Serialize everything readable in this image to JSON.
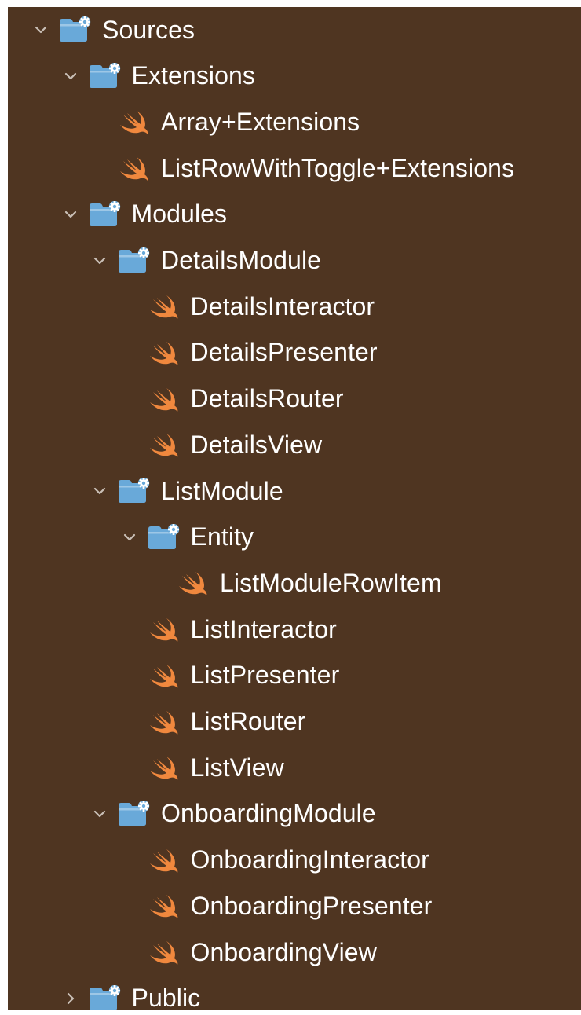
{
  "tree": [
    {
      "label": "Sources",
      "kind": "folder",
      "depth": 0,
      "state": "expanded",
      "icon": "folder-gear-icon"
    },
    {
      "label": "Extensions",
      "kind": "folder",
      "depth": 1,
      "state": "expanded",
      "icon": "folder-gear-icon"
    },
    {
      "label": "Array+Extensions",
      "kind": "file",
      "depth": 2,
      "icon": "swift-icon"
    },
    {
      "label": "ListRowWithToggle+Extensions",
      "kind": "file",
      "depth": 2,
      "icon": "swift-icon"
    },
    {
      "label": "Modules",
      "kind": "folder",
      "depth": 1,
      "state": "expanded",
      "icon": "folder-gear-icon"
    },
    {
      "label": "DetailsModule",
      "kind": "folder",
      "depth": 2,
      "state": "expanded",
      "icon": "folder-gear-icon"
    },
    {
      "label": "DetailsInteractor",
      "kind": "file",
      "depth": 3,
      "icon": "swift-icon"
    },
    {
      "label": "DetailsPresenter",
      "kind": "file",
      "depth": 3,
      "icon": "swift-icon"
    },
    {
      "label": "DetailsRouter",
      "kind": "file",
      "depth": 3,
      "icon": "swift-icon"
    },
    {
      "label": "DetailsView",
      "kind": "file",
      "depth": 3,
      "icon": "swift-icon"
    },
    {
      "label": "ListModule",
      "kind": "folder",
      "depth": 2,
      "state": "expanded",
      "icon": "folder-gear-icon"
    },
    {
      "label": "Entity",
      "kind": "folder",
      "depth": 3,
      "state": "expanded",
      "icon": "folder-gear-icon"
    },
    {
      "label": "ListModuleRowItem",
      "kind": "file",
      "depth": 4,
      "icon": "swift-icon"
    },
    {
      "label": "ListInteractor",
      "kind": "file",
      "depth": 3,
      "icon": "swift-icon"
    },
    {
      "label": "ListPresenter",
      "kind": "file",
      "depth": 3,
      "icon": "swift-icon"
    },
    {
      "label": "ListRouter",
      "kind": "file",
      "depth": 3,
      "icon": "swift-icon"
    },
    {
      "label": "ListView",
      "kind": "file",
      "depth": 3,
      "icon": "swift-icon"
    },
    {
      "label": "OnboardingModule",
      "kind": "folder",
      "depth": 2,
      "state": "expanded",
      "icon": "folder-gear-icon"
    },
    {
      "label": "OnboardingInteractor",
      "kind": "file",
      "depth": 3,
      "icon": "swift-icon"
    },
    {
      "label": "OnboardingPresenter",
      "kind": "file",
      "depth": 3,
      "icon": "swift-icon"
    },
    {
      "label": "OnboardingView",
      "kind": "file",
      "depth": 3,
      "icon": "swift-icon"
    },
    {
      "label": "Public",
      "kind": "folder",
      "depth": 1,
      "state": "collapsed",
      "icon": "folder-gear-icon"
    }
  ],
  "colors": {
    "background": "#4f3521",
    "text": "#ffffff",
    "folder": "#69a9d9",
    "swift": "#f0883e",
    "chevron": "#c9bfb6"
  }
}
